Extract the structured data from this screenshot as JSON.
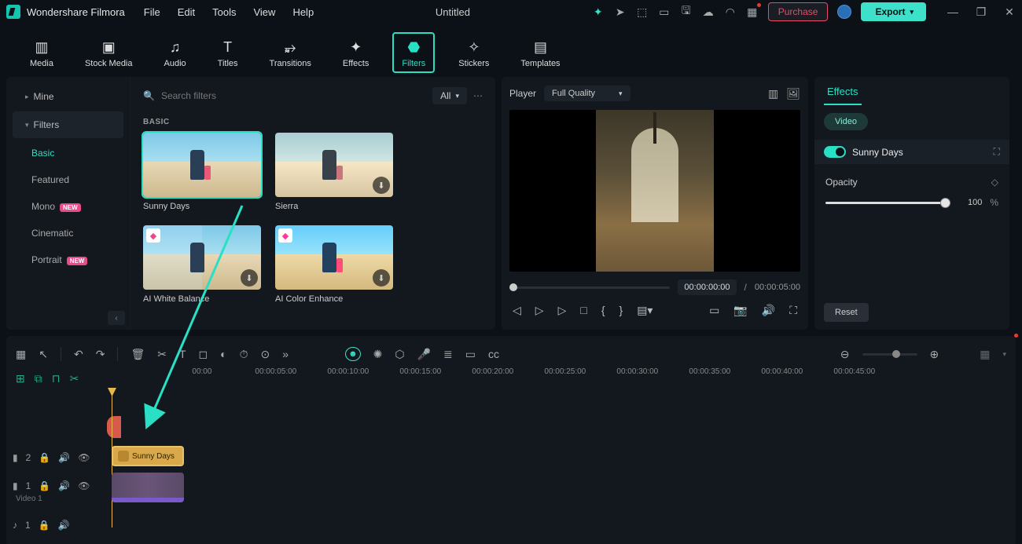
{
  "app": {
    "name": "Wondershare Filmora",
    "project": "Untitled"
  },
  "menu": {
    "file": "File",
    "edit": "Edit",
    "tools": "Tools",
    "view": "View",
    "help": "Help"
  },
  "titlebtns": {
    "purchase": "Purchase",
    "export": "Export"
  },
  "tooltabs": {
    "media": "Media",
    "stock": "Stock Media",
    "audio": "Audio",
    "titles": "Titles",
    "transitions": "Transitions",
    "effects": "Effects",
    "filters": "Filters",
    "stickers": "Stickers",
    "templates": "Templates"
  },
  "sidebar": {
    "mine": "Mine",
    "filters": "Filters",
    "items": [
      "Basic",
      "Featured",
      "Mono",
      "Cinematic",
      "Portrait"
    ],
    "new_badge": "NEW"
  },
  "search": {
    "placeholder": "Search filters",
    "all": "All"
  },
  "section": {
    "basic": "BASIC"
  },
  "thumbs": {
    "sunny": "Sunny Days",
    "sierra": "Sierra",
    "aiwb": "AI White Balance",
    "aice": "AI Color Enhance"
  },
  "player": {
    "label": "Player",
    "quality": "Full Quality",
    "current": "00:00:00:00",
    "sep": "/",
    "total": "00:00:05:00"
  },
  "props": {
    "tab": "Effects",
    "video": "Video",
    "filter_name": "Sunny Days",
    "opacity": "Opacity",
    "opacity_val": "100",
    "pct": "%",
    "reset": "Reset"
  },
  "ruler": {
    "t0": "00:00",
    "t1": "00:00:05:00",
    "t2": "00:00:10:00",
    "t3": "00:00:15:00",
    "t4": "00:00:20:00",
    "t5": "00:00:25:00",
    "t6": "00:00:30:00",
    "t7": "00:00:35:00",
    "t8": "00:00:40:00",
    "t9": "00:00:45:00"
  },
  "tracks": {
    "v2": "2",
    "v1": "1",
    "v1label": "Video 1",
    "a1": "1"
  },
  "clip": {
    "filter": "Sunny Days"
  }
}
